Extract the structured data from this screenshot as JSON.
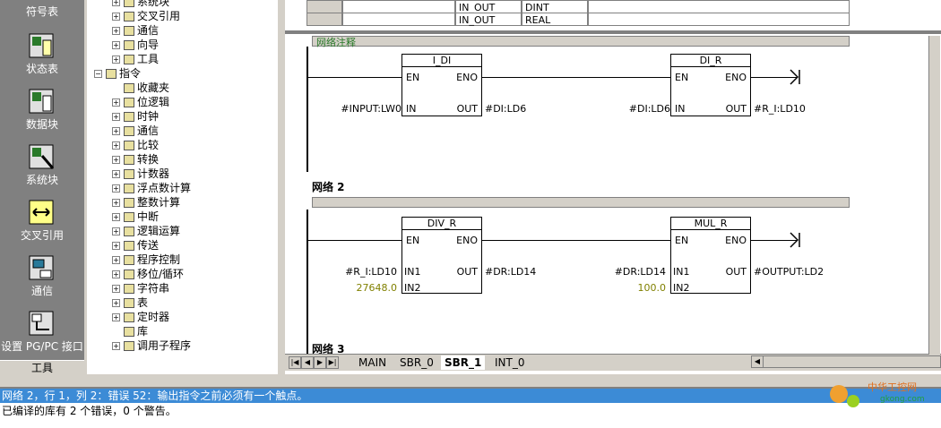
{
  "navbar": {
    "items": [
      {
        "label": "符号表"
      },
      {
        "label": "状态表"
      },
      {
        "label": "数据块"
      },
      {
        "label": "系统块"
      },
      {
        "label": "交叉引用"
      },
      {
        "label": "通信"
      },
      {
        "label": "设置 PG/PC 接口"
      }
    ],
    "footer": "工具"
  },
  "tree": {
    "items": [
      {
        "label": "系统块",
        "icon": "system-block-icon"
      },
      {
        "label": "交叉引用",
        "icon": "cross-ref-icon"
      },
      {
        "label": "通信",
        "icon": "comm-icon"
      },
      {
        "label": "向导",
        "icon": "wizard-icon"
      },
      {
        "label": "工具",
        "icon": "tools-icon"
      },
      {
        "label": "指令",
        "icon": "instructions-icon"
      },
      {
        "label": "收藏夹",
        "icon": "favorites-icon"
      },
      {
        "label": "位逻辑",
        "icon": "bit-logic-icon"
      },
      {
        "label": "时钟",
        "icon": "clock-icon"
      },
      {
        "label": "通信",
        "icon": "comm-icon"
      },
      {
        "label": "比较",
        "icon": "compare-icon"
      },
      {
        "label": "转换",
        "icon": "convert-icon"
      },
      {
        "label": "计数器",
        "icon": "counter-icon"
      },
      {
        "label": "浮点数计算",
        "icon": "float-math-icon"
      },
      {
        "label": "整数计算",
        "icon": "int-math-icon"
      },
      {
        "label": "中断",
        "icon": "interrupt-icon"
      },
      {
        "label": "逻辑运算",
        "icon": "logic-op-icon"
      },
      {
        "label": "传送",
        "icon": "move-icon"
      },
      {
        "label": "程序控制",
        "icon": "program-control-icon"
      },
      {
        "label": "移位/循环",
        "icon": "shift-rotate-icon"
      },
      {
        "label": "字符串",
        "icon": "string-icon"
      },
      {
        "label": "表",
        "icon": "table-icon"
      },
      {
        "label": "定时器",
        "icon": "timer-icon"
      },
      {
        "label": "库",
        "icon": "library-icon"
      },
      {
        "label": "调用子程序",
        "icon": "call-subroutine-icon"
      }
    ]
  },
  "var_table": {
    "rows": [
      {
        "type": "IN_OUT",
        "dtype": "DINT"
      },
      {
        "type": "IN_OUT",
        "dtype": "REAL"
      }
    ]
  },
  "networks": {
    "net1_comment": "网络注释",
    "net2_label": "网络 2",
    "net3_label": "网络 3",
    "boxes": {
      "idi": {
        "title": "I_DI",
        "en": "EN",
        "eno": "ENO",
        "in": "IN",
        "out": "OUT",
        "in_op": "#INPUT:LW0",
        "out_op": "#DI:LD6"
      },
      "dir": {
        "title": "DI_R",
        "en": "EN",
        "eno": "ENO",
        "in": "IN",
        "out": "OUT",
        "in_op": "#DI:LD6",
        "out_op": "#R_I:LD10"
      },
      "divr": {
        "title": "DIV_R",
        "en": "EN",
        "eno": "ENO",
        "in1": "IN1",
        "in2": "IN2",
        "out": "OUT",
        "in1_op": "#R_I:LD10",
        "in2_op": "27648.0",
        "out_op": "#DR:LD14"
      },
      "mulr": {
        "title": "MUL_R",
        "en": "EN",
        "eno": "ENO",
        "in1": "IN1",
        "in2": "IN2",
        "out": "OUT",
        "in1_op": "#DR:LD14",
        "in2_op": "100.0",
        "out_op": "#OUTPUT:LD2"
      }
    }
  },
  "tabs": [
    "MAIN",
    "SBR_0",
    "SBR_1",
    "INT_0"
  ],
  "active_tab": "SBR_1",
  "output": {
    "line1": "网络 2，行 1，列 2：错误 52：输出指令之前必须有一个触点。",
    "line2": "已编译的库有 2 个错误，0 个警告。"
  },
  "watermark": {
    "text1": "中华工控网",
    "text2": "gkong.com"
  },
  "colors": {
    "error_highlight": "#3c8bd6",
    "constant": "#808000",
    "nav_bg": "#808080"
  }
}
